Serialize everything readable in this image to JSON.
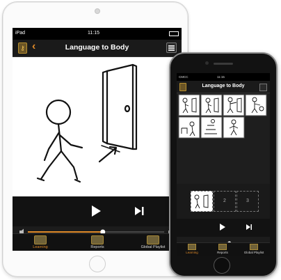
{
  "ipad": {
    "status": {
      "carrier": "iPad",
      "time": "11:15"
    },
    "title": "Language to Body",
    "back": "‹",
    "info": "i",
    "tabs": [
      {
        "label": "Learning",
        "icon": "graduation-cap-icon",
        "active": true
      },
      {
        "label": "Reports",
        "icon": "bar-chart-icon",
        "active": false
      },
      {
        "label": "Global Playlist",
        "icon": "playlist-icon",
        "active": false
      }
    ],
    "volume_level": 0.55
  },
  "iphone": {
    "status": {
      "carrier": "CMCC",
      "time": "11:15"
    },
    "title": "Language to Body",
    "slots": [
      "2",
      "3"
    ],
    "tabs": [
      {
        "label": "Learning",
        "icon": "graduation-cap-icon",
        "active": true
      },
      {
        "label": "Reports",
        "icon": "bar-chart-icon",
        "active": false
      },
      {
        "label": "Global Playlist",
        "icon": "playlist-icon",
        "active": false
      }
    ],
    "volume_level": 0.58
  },
  "colors": {
    "accent": "#e08a28",
    "bar": "#1a1a1a",
    "canvas": "#ffffff"
  }
}
